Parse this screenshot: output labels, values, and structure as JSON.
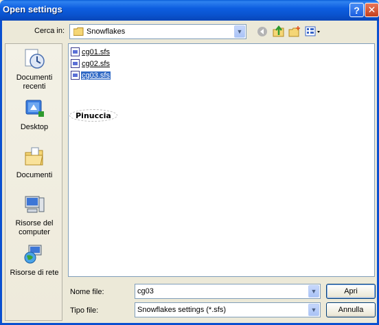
{
  "window": {
    "title": "Open settings"
  },
  "titlebar": {
    "help_glyph": "?",
    "close_glyph": "✕"
  },
  "lookin": {
    "label": "Cerca in:",
    "value": "Snowflakes"
  },
  "places": [
    {
      "label": "Documenti recenti",
      "icon": "recent-documents-icon"
    },
    {
      "label": "Desktop",
      "icon": "desktop-icon"
    },
    {
      "label": "Documenti",
      "icon": "documents-folder-icon"
    },
    {
      "label": "Risorse del computer",
      "icon": "my-computer-icon"
    },
    {
      "label": "Risorse di rete",
      "icon": "network-icon"
    }
  ],
  "files": [
    {
      "name": "cg01.sfs",
      "selected": false
    },
    {
      "name": "cg02.sfs",
      "selected": false
    },
    {
      "name": "cg03.sfs",
      "selected": true
    }
  ],
  "watermark": "Pinuccia",
  "filename": {
    "label": "Nome file:",
    "value": "cg03"
  },
  "filetype": {
    "label": "Tipo file:",
    "value": "Snowflakes settings (*.sfs)"
  },
  "buttons": {
    "open": "Apri",
    "cancel": "Annulla"
  },
  "colors": {
    "titlebar": "#0a54d0",
    "selection": "#316ac5",
    "dialog_bg": "#ece9d8"
  }
}
